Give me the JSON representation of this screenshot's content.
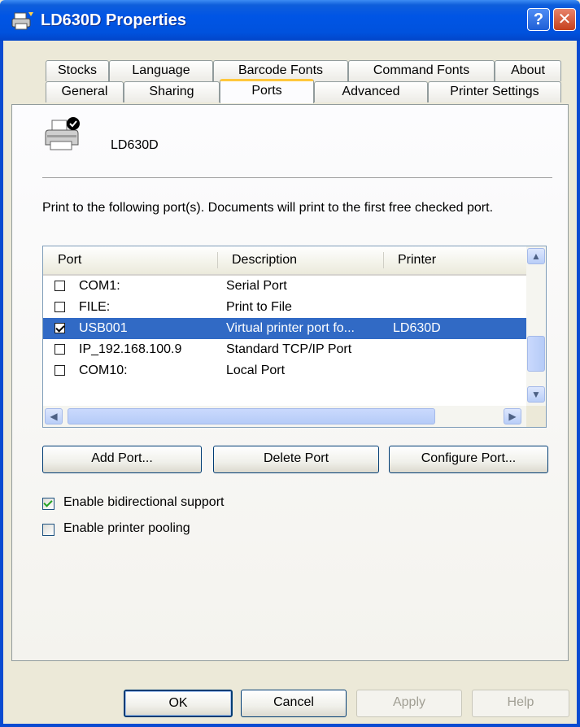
{
  "window": {
    "title": "LD630D Properties",
    "help_glyph": "?",
    "close_glyph": "✕"
  },
  "tabs": {
    "row1": [
      "Stocks",
      "Language",
      "Barcode Fonts",
      "Command Fonts",
      "About"
    ],
    "row2": [
      "General",
      "Sharing",
      "Ports",
      "Advanced",
      "Printer Settings"
    ],
    "active": "Ports"
  },
  "printer": {
    "name": "LD630D",
    "icon": "printer-icon"
  },
  "instructions": "Print to the following port(s). Documents will print to the first free checked port.",
  "port_list": {
    "headers": [
      "Port",
      "Description",
      "Printer"
    ],
    "rows": [
      {
        "checked": false,
        "port": "COM1:",
        "description": "Serial Port",
        "printer": ""
      },
      {
        "checked": false,
        "port": "FILE:",
        "description": "Print to File",
        "printer": ""
      },
      {
        "checked": true,
        "port": "USB001",
        "description": "Virtual printer port fo...",
        "printer": "LD630D",
        "selected": true
      },
      {
        "checked": false,
        "port": "IP_192.168.100.9",
        "description": "Standard TCP/IP Port",
        "printer": ""
      },
      {
        "checked": false,
        "port": "COM10:",
        "description": "Local Port",
        "printer": ""
      }
    ],
    "selection_color": "#316AC5"
  },
  "port_buttons": {
    "add": "Add Port...",
    "delete": "Delete Port",
    "configure": "Configure Port..."
  },
  "options": {
    "bidirectional": {
      "label": "Enable bidirectional support",
      "checked": true
    },
    "pooling": {
      "label": "Enable printer pooling",
      "checked": false
    }
  },
  "dialog_buttons": {
    "ok": "OK",
    "cancel": "Cancel",
    "apply": "Apply",
    "help": "Help"
  },
  "colors": {
    "titlebar": "#0055E5",
    "dialog_bg": "#ECE9D8",
    "active_tab_accent": "#FFC73C"
  }
}
